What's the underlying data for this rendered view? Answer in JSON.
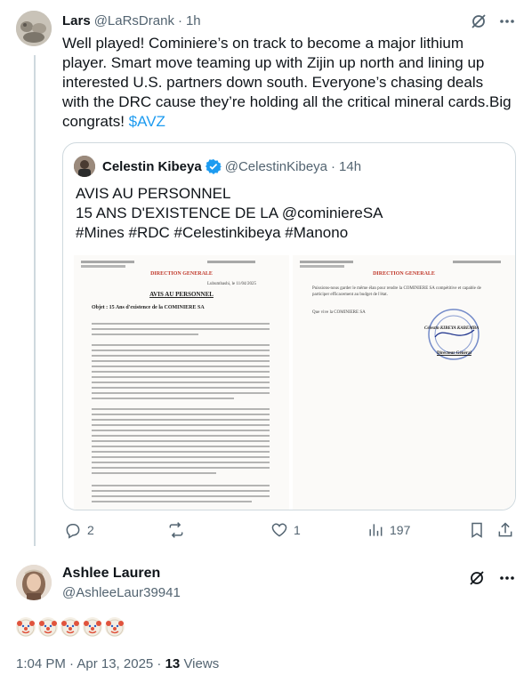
{
  "reply": {
    "display_name": "Lars",
    "handle": "@LaRsDrank",
    "time": "1h",
    "text": "Well played! Cominiere’s on track to become a major lithium player. Smart move teaming up with Zijin up north and lining up interested U.S. partners down south. Everyone’s chasing deals with the DRC cause they’re holding all the critical mineral cards.Big congrats!",
    "cashtag": "$AVZ"
  },
  "quoted": {
    "display_name": "Celestin Kibeya",
    "handle": "@CelestinKibeya",
    "time": "14h",
    "line1": "AVIS AU PERSONNEL",
    "line2": "15 ANS D'EXISTENCE DE LA @cominiereSA",
    "line3": "#Mines #RDC #Celestinkibeya #Manono",
    "doc": {
      "left_header": "DIRECTION GENERALE",
      "left_date": "Lubumbashi, le 11/04/2025",
      "left_title": "AVIS AU PERSONNEL",
      "left_object": "Objet : 15 Ans d'existence de la COMINIERE SA",
      "right_header": "DIRECTION GENERALE",
      "right_intro": "Puissions-nous garder le même élan pour rendre la COMINIERE SA compétitive et capable de participer efficacement au budget de l'état.",
      "right_vive": "Que vive la COMINIERE SA",
      "right_signer": "Célestin KIBEYA KABEMBA",
      "right_role": "Directeur Général"
    }
  },
  "actions": {
    "replies": "2",
    "reposts": "",
    "likes": "1",
    "views": "197"
  },
  "main_post": {
    "display_name": "Ashlee Lauren",
    "handle": "@AshleeLaur39941",
    "emoji_text": "🤡🤡🤡🤡🤡",
    "timestamp": "1:04 PM · Apr 13, 2025 · ",
    "views_count": "13",
    "views_label": " Views"
  },
  "colors": {
    "accent": "#1d9bf0",
    "muted": "#536471",
    "border": "#cfd9de",
    "verified": "#1d9bf0"
  },
  "icons": [
    "grok-icon",
    "more-icon",
    "verified-badge-icon",
    "reply-icon",
    "repost-icon",
    "like-icon",
    "views-icon",
    "bookmark-icon",
    "share-icon",
    "clown-emoji"
  ]
}
